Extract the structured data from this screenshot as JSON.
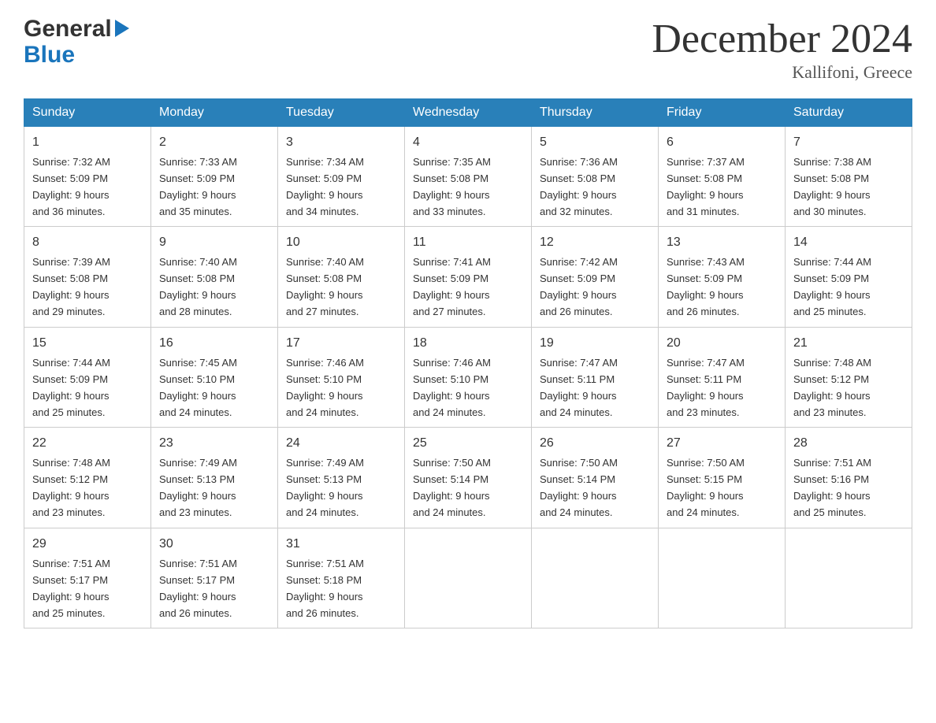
{
  "logo": {
    "general": "General",
    "blue": "Blue",
    "arrow": "▶"
  },
  "title": "December 2024",
  "location": "Kallifoni, Greece",
  "days_of_week": [
    "Sunday",
    "Monday",
    "Tuesday",
    "Wednesday",
    "Thursday",
    "Friday",
    "Saturday"
  ],
  "weeks": [
    [
      {
        "day": "1",
        "sunrise": "7:32 AM",
        "sunset": "5:09 PM",
        "daylight": "9 hours and 36 minutes."
      },
      {
        "day": "2",
        "sunrise": "7:33 AM",
        "sunset": "5:09 PM",
        "daylight": "9 hours and 35 minutes."
      },
      {
        "day": "3",
        "sunrise": "7:34 AM",
        "sunset": "5:09 PM",
        "daylight": "9 hours and 34 minutes."
      },
      {
        "day": "4",
        "sunrise": "7:35 AM",
        "sunset": "5:08 PM",
        "daylight": "9 hours and 33 minutes."
      },
      {
        "day": "5",
        "sunrise": "7:36 AM",
        "sunset": "5:08 PM",
        "daylight": "9 hours and 32 minutes."
      },
      {
        "day": "6",
        "sunrise": "7:37 AM",
        "sunset": "5:08 PM",
        "daylight": "9 hours and 31 minutes."
      },
      {
        "day": "7",
        "sunrise": "7:38 AM",
        "sunset": "5:08 PM",
        "daylight": "9 hours and 30 minutes."
      }
    ],
    [
      {
        "day": "8",
        "sunrise": "7:39 AM",
        "sunset": "5:08 PM",
        "daylight": "9 hours and 29 minutes."
      },
      {
        "day": "9",
        "sunrise": "7:40 AM",
        "sunset": "5:08 PM",
        "daylight": "9 hours and 28 minutes."
      },
      {
        "day": "10",
        "sunrise": "7:40 AM",
        "sunset": "5:08 PM",
        "daylight": "9 hours and 27 minutes."
      },
      {
        "day": "11",
        "sunrise": "7:41 AM",
        "sunset": "5:09 PM",
        "daylight": "9 hours and 27 minutes."
      },
      {
        "day": "12",
        "sunrise": "7:42 AM",
        "sunset": "5:09 PM",
        "daylight": "9 hours and 26 minutes."
      },
      {
        "day": "13",
        "sunrise": "7:43 AM",
        "sunset": "5:09 PM",
        "daylight": "9 hours and 26 minutes."
      },
      {
        "day": "14",
        "sunrise": "7:44 AM",
        "sunset": "5:09 PM",
        "daylight": "9 hours and 25 minutes."
      }
    ],
    [
      {
        "day": "15",
        "sunrise": "7:44 AM",
        "sunset": "5:09 PM",
        "daylight": "9 hours and 25 minutes."
      },
      {
        "day": "16",
        "sunrise": "7:45 AM",
        "sunset": "5:10 PM",
        "daylight": "9 hours and 24 minutes."
      },
      {
        "day": "17",
        "sunrise": "7:46 AM",
        "sunset": "5:10 PM",
        "daylight": "9 hours and 24 minutes."
      },
      {
        "day": "18",
        "sunrise": "7:46 AM",
        "sunset": "5:10 PM",
        "daylight": "9 hours and 24 minutes."
      },
      {
        "day": "19",
        "sunrise": "7:47 AM",
        "sunset": "5:11 PM",
        "daylight": "9 hours and 24 minutes."
      },
      {
        "day": "20",
        "sunrise": "7:47 AM",
        "sunset": "5:11 PM",
        "daylight": "9 hours and 23 minutes."
      },
      {
        "day": "21",
        "sunrise": "7:48 AM",
        "sunset": "5:12 PM",
        "daylight": "9 hours and 23 minutes."
      }
    ],
    [
      {
        "day": "22",
        "sunrise": "7:48 AM",
        "sunset": "5:12 PM",
        "daylight": "9 hours and 23 minutes."
      },
      {
        "day": "23",
        "sunrise": "7:49 AM",
        "sunset": "5:13 PM",
        "daylight": "9 hours and 23 minutes."
      },
      {
        "day": "24",
        "sunrise": "7:49 AM",
        "sunset": "5:13 PM",
        "daylight": "9 hours and 24 minutes."
      },
      {
        "day": "25",
        "sunrise": "7:50 AM",
        "sunset": "5:14 PM",
        "daylight": "9 hours and 24 minutes."
      },
      {
        "day": "26",
        "sunrise": "7:50 AM",
        "sunset": "5:14 PM",
        "daylight": "9 hours and 24 minutes."
      },
      {
        "day": "27",
        "sunrise": "7:50 AM",
        "sunset": "5:15 PM",
        "daylight": "9 hours and 24 minutes."
      },
      {
        "day": "28",
        "sunrise": "7:51 AM",
        "sunset": "5:16 PM",
        "daylight": "9 hours and 25 minutes."
      }
    ],
    [
      {
        "day": "29",
        "sunrise": "7:51 AM",
        "sunset": "5:17 PM",
        "daylight": "9 hours and 25 minutes."
      },
      {
        "day": "30",
        "sunrise": "7:51 AM",
        "sunset": "5:17 PM",
        "daylight": "9 hours and 26 minutes."
      },
      {
        "day": "31",
        "sunrise": "7:51 AM",
        "sunset": "5:18 PM",
        "daylight": "9 hours and 26 minutes."
      },
      null,
      null,
      null,
      null
    ]
  ],
  "labels": {
    "sunrise": "Sunrise: ",
    "sunset": "Sunset: ",
    "daylight": "Daylight: "
  }
}
